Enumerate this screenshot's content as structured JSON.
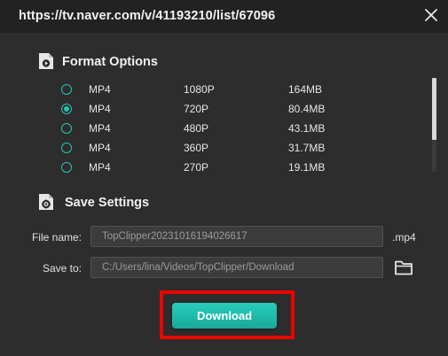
{
  "window": {
    "url": "https://tv.naver.com/v/41193210/list/67096"
  },
  "format_section": {
    "title": "Format Options",
    "icon": "video-file-icon",
    "options": [
      {
        "format": "MP4",
        "resolution": "1080P",
        "size": "164MB",
        "selected": false
      },
      {
        "format": "MP4",
        "resolution": "720P",
        "size": "80.4MB",
        "selected": true
      },
      {
        "format": "MP4",
        "resolution": "480P",
        "size": "43.1MB",
        "selected": false
      },
      {
        "format": "MP4",
        "resolution": "360P",
        "size": "31.7MB",
        "selected": false
      },
      {
        "format": "MP4",
        "resolution": "270P",
        "size": "19.1MB",
        "selected": false
      }
    ]
  },
  "save_section": {
    "title": "Save Settings",
    "icon": "settings-file-icon",
    "file_name_label": "File name:",
    "file_name_value": "TopClipper20231016194026617",
    "extension": ".mp4",
    "save_to_label": "Save to:",
    "save_to_value": "C:/Users/lina/Videos/TopClipper/Download",
    "folder_icon": "folder-icon"
  },
  "actions": {
    "download_label": "Download"
  },
  "colors": {
    "accent": "#22c4b4",
    "highlight": "#ee0000",
    "background": "#2d2d2d",
    "titlebar": "#222222"
  }
}
